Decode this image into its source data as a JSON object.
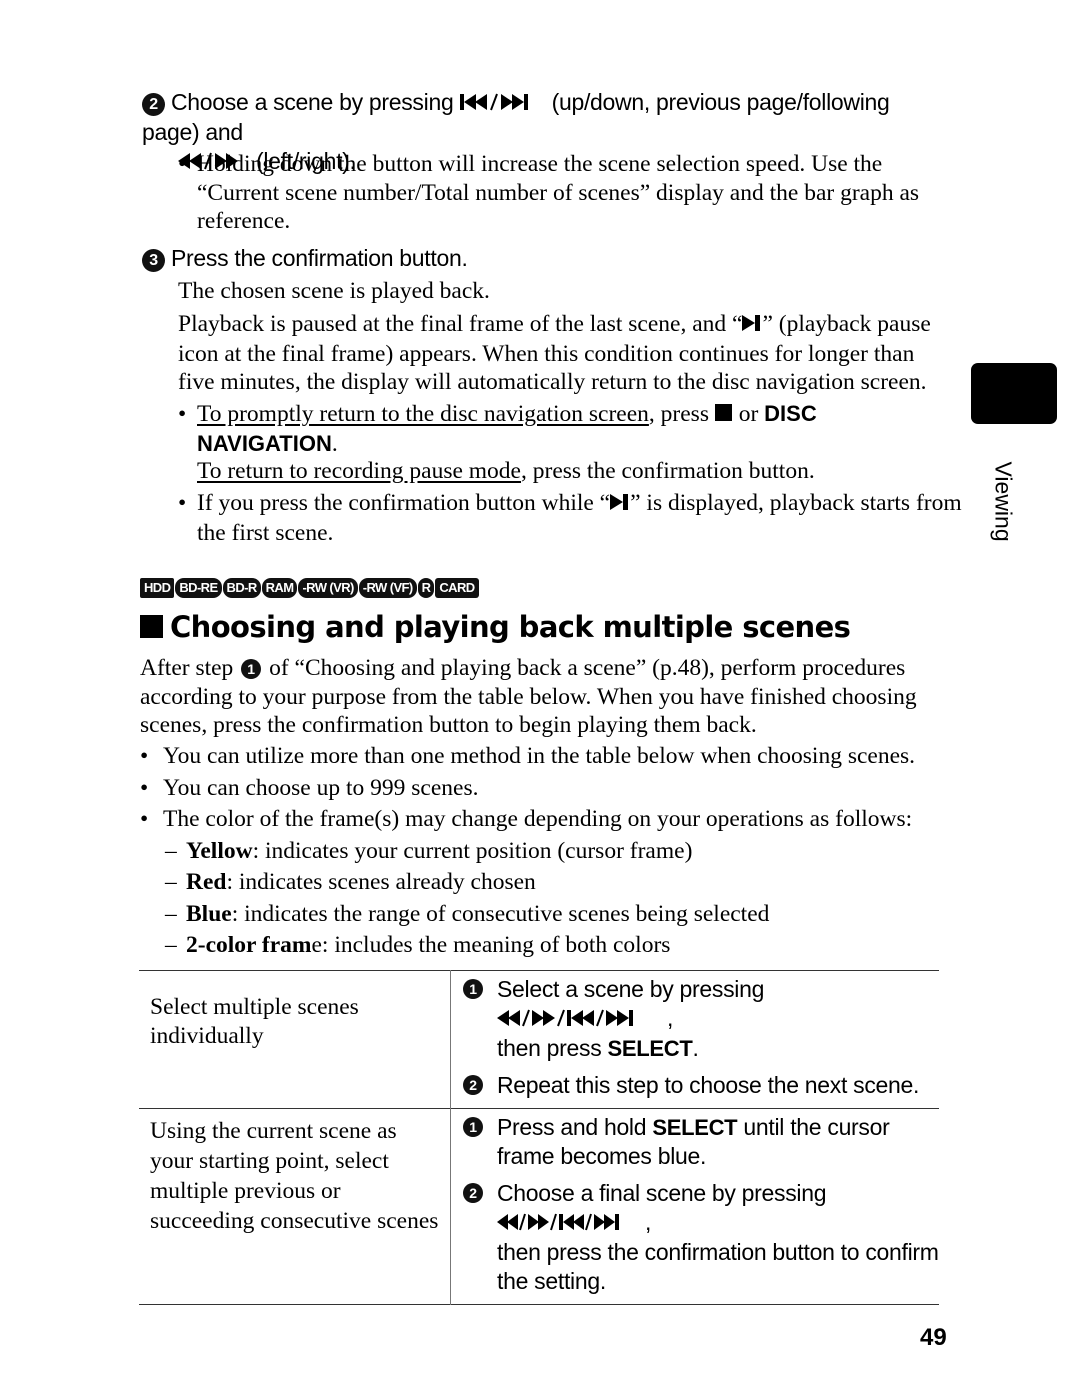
{
  "step2": {
    "number": "2",
    "text_a": "Choose a scene by pressing",
    "icon_a": "skip-prev-next-icon",
    "text_b": "(up/down, previous page/following page) and",
    "icon_b": "rewind-forward-icon",
    "text_c": "(left/right).",
    "note": "Holding down the button will increase the scene selection speed. Use the “Current scene number/Total number of scenes” display and the bar graph as reference."
  },
  "step3": {
    "number": "3",
    "title": "Press the confirmation button.",
    "para1": "The chosen scene is played back.",
    "para2_a": "Playback is paused at the final frame of the last scene, and “",
    "para2_icon": "playback-pause-final-frame-icon",
    "para2_b": "” (playback pause icon at the final frame) appears. When this condition continues for longer than five minutes, the display will automatically return to the disc navigation screen.",
    "bullet1_link": "To promptly return to the disc navigation screen",
    "bullet1_mid": ", press ",
    "bullet1_icon": "stop-icon",
    "bullet1_or": " or ",
    "bullet1_button": "DISC NAVIGATION",
    "bullet1_end": ".",
    "bullet1_link2": "To return to recording pause mode",
    "bullet1_end2": ", press the confirmation button.",
    "bullet2_a": "If you press the confirmation button while “",
    "bullet2_b": "” is displayed, playback starts from the first scene."
  },
  "media_tags": [
    "HDD",
    "BD-RE",
    "BD-R",
    "RAM",
    "-RW (VR)",
    "-RW (VF)",
    "R",
    "CARD"
  ],
  "section": {
    "title": "Choosing and playing back multiple scenes",
    "intro_a": "After step",
    "intro_step": "1",
    "intro_b": "of “Choosing and playing back a scene” (p.48), perform procedures according to your purpose from the table below. When you have finished choosing scenes, press the confirmation button to begin playing them back.",
    "bullets": [
      "You can utilize more than one method in the table below when choosing scenes.",
      "You can choose up to 999 scenes.",
      "The color of the frame(s) may change depending on your operations as follows:"
    ],
    "colors": [
      {
        "bold": "Yellow",
        "rest": ": indicates your current position (cursor frame)"
      },
      {
        "bold": "Red",
        "rest": ": indicates scenes already chosen"
      },
      {
        "bold": "Blue",
        "rest": ": indicates the range of consecutive scenes being selected"
      },
      {
        "bold": "2-color fram",
        "rest": "e: includes the meaning of both colors"
      }
    ]
  },
  "table": {
    "rows": [
      {
        "purpose": "Select multiple scenes individually",
        "steps": [
          {
            "n": "1",
            "a": "Select a scene by pressing ",
            "icon": "rewind-forward-skip-icon",
            "b": ",",
            "c": "then press ",
            "bold": "SELECT",
            "d": "."
          },
          {
            "n": "2",
            "a": "Repeat this step to choose the next scene."
          }
        ]
      },
      {
        "purpose": "Using the current scene as your starting point, select multiple previous or succeeding consecutive scenes",
        "steps": [
          {
            "n": "1",
            "a": "Press and hold ",
            "bold": "SELECT",
            "b": " until the cursor frame becomes blue."
          },
          {
            "n": "2",
            "a": "Choose a final scene by pressing ",
            "icon": "rewind-forward-skip-icon",
            "b": ",",
            "c": "then press the confirmation button to confirm the setting."
          }
        ]
      }
    ]
  },
  "side_tab": {
    "label": "Viewing"
  },
  "page_number": "49"
}
